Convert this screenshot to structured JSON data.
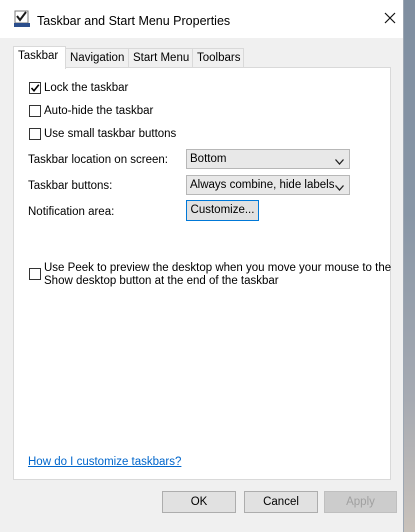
{
  "window": {
    "title": "Taskbar and Start Menu Properties",
    "icons": {
      "app": "taskbar-properties-icon",
      "close": "close-icon"
    }
  },
  "tabs": [
    {
      "label": "Taskbar",
      "active": true
    },
    {
      "label": "Navigation",
      "active": false
    },
    {
      "label": "Start Menu",
      "active": false
    },
    {
      "label": "Toolbars",
      "active": false
    }
  ],
  "options": {
    "lock_taskbar": {
      "label": "Lock the taskbar",
      "checked": true
    },
    "auto_hide": {
      "label": "Auto-hide the taskbar",
      "checked": false
    },
    "small_buttons": {
      "label": "Use small taskbar buttons",
      "checked": false
    }
  },
  "location": {
    "label": "Taskbar location on screen:",
    "value": "Bottom"
  },
  "buttons_setting": {
    "label": "Taskbar buttons:",
    "value": "Always combine, hide labels"
  },
  "notification": {
    "label": "Notification area:",
    "button": "Customize..."
  },
  "peek": {
    "line1": "Use Peek to preview the desktop when you move your mouse to the",
    "line2": "Show desktop button at the end of the taskbar",
    "checked": false
  },
  "help_link": "How do I customize taskbars?",
  "footer": {
    "ok": "OK",
    "cancel": "Cancel",
    "apply": "Apply"
  }
}
